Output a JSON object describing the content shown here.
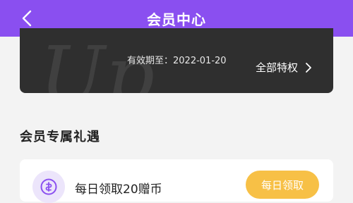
{
  "header": {
    "title": "会员中心",
    "back_icon": "chevron-left-icon"
  },
  "member_card": {
    "watermark_text": "Up",
    "expire_text": "有效期至：2022-01-20",
    "all_perks_label": "全部特权",
    "all_perks_icon": "chevron-right-icon"
  },
  "section": {
    "title": "会员专属礼遇"
  },
  "reward": {
    "icon": "coin-icon",
    "label": "每日领取20赠币",
    "button_label": "每日领取"
  },
  "colors": {
    "header_bg": "#8a4ff0",
    "card_bg": "#2f2f2f",
    "button_bg": "#f7c046",
    "icon_bg": "#ece5fb",
    "page_bg": "#f3f3f3"
  }
}
